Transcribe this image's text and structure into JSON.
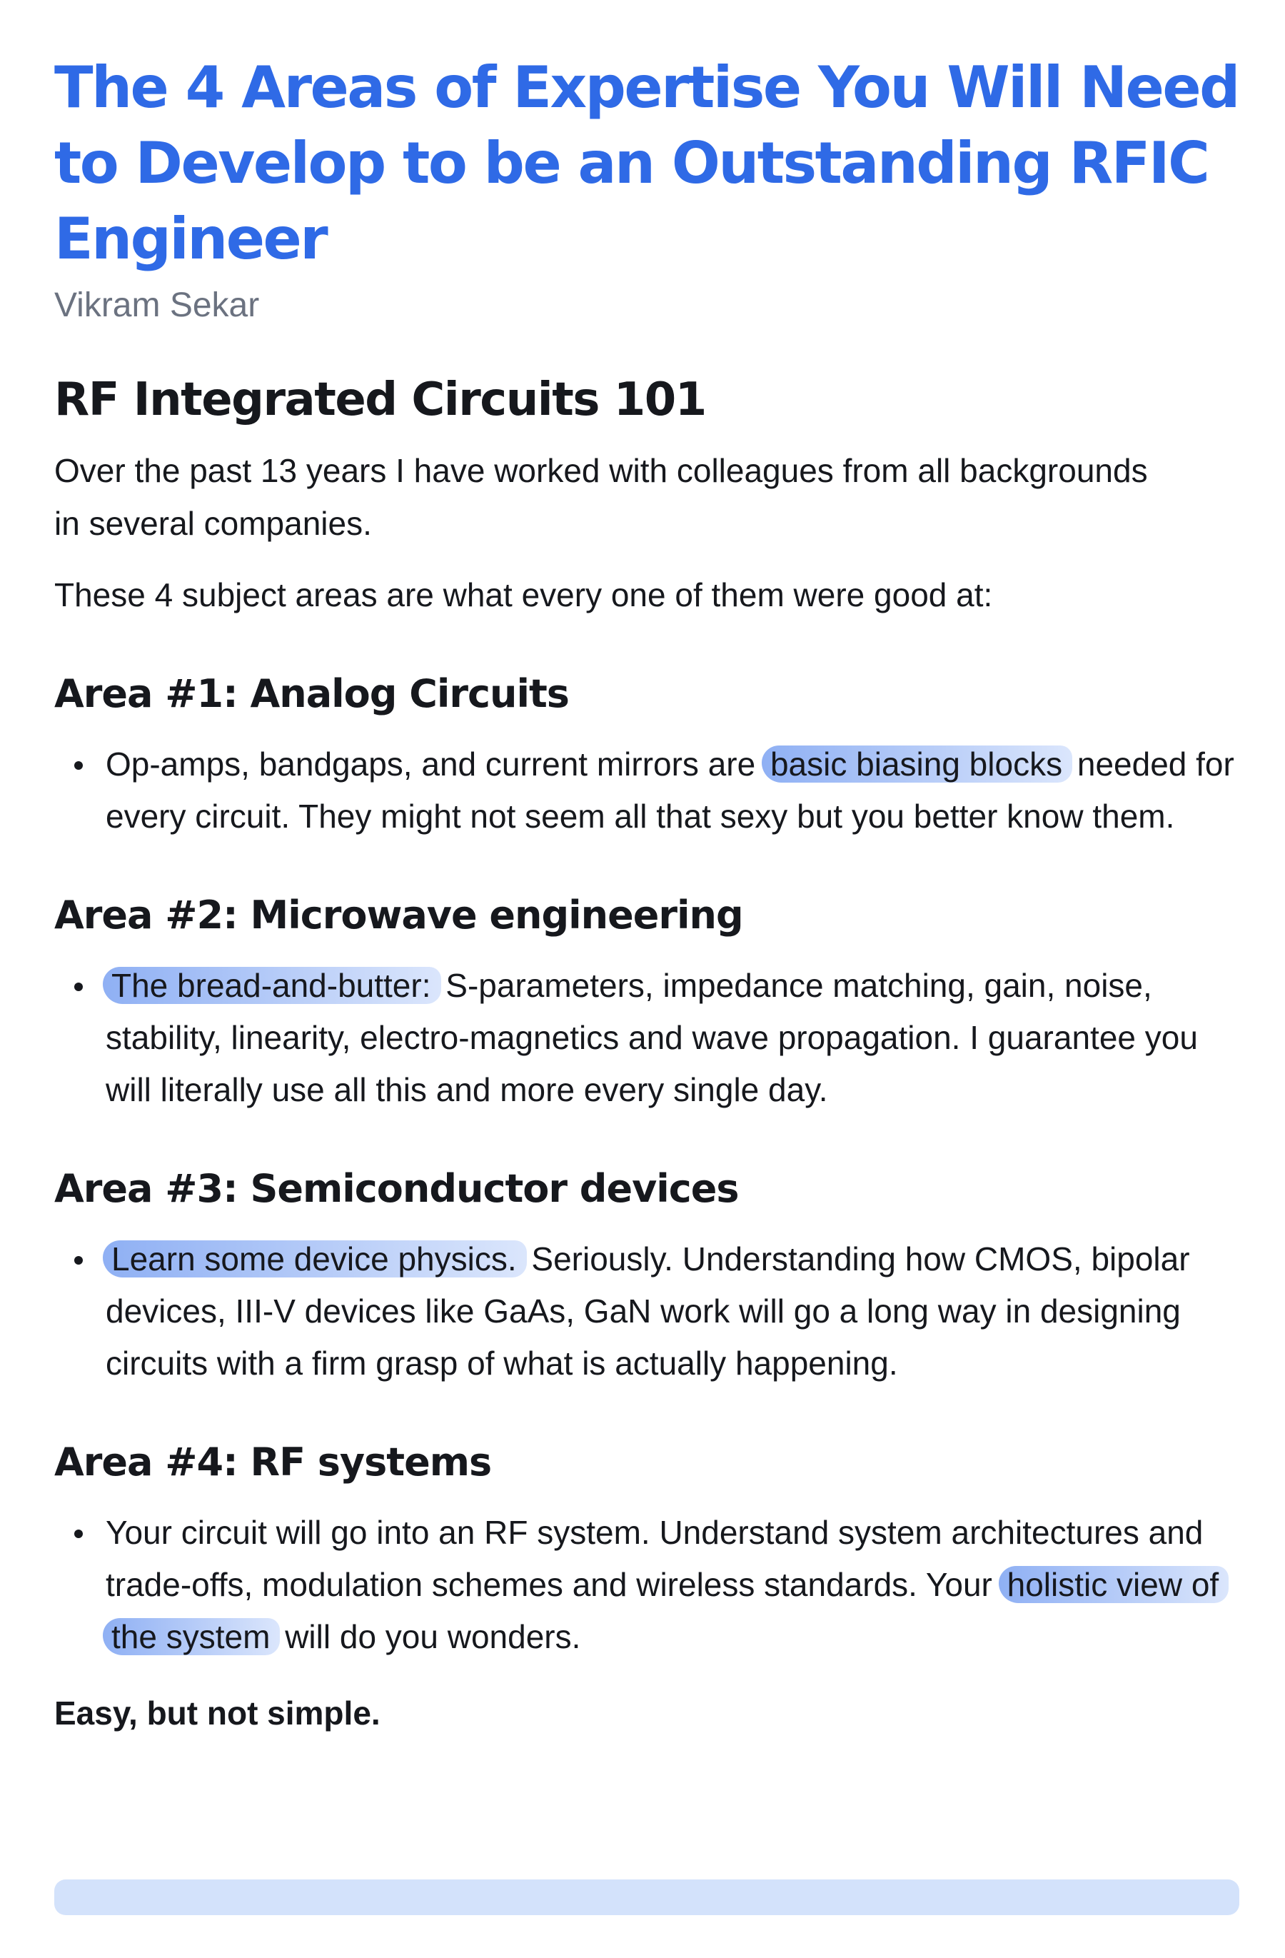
{
  "article": {
    "title": "The 4 Areas of Expertise You Will Need to Develop to be an Outstanding RFIC Engineer",
    "author": "Vikram Sekar",
    "section_title": "RF Integrated Circuits 101",
    "intro": [
      "Over the past 13 years I have worked with colleagues from all backgrounds in several companies.",
      "These 4 subject areas are what every one of them were good at:"
    ],
    "areas": [
      {
        "heading": "Area #1: Analog Circuits",
        "before": "Op-amps, bandgaps, and current mirrors are ",
        "highlight": "basic biasing blocks",
        "after": " needed for every circuit. They might not seem all that sexy but you better know them."
      },
      {
        "heading": "Area #2: Microwave engineering",
        "before": "",
        "highlight": "The bread-and-butter:",
        "after": " S-parameters, impedance matching, gain, noise, stability, linearity, electro-magnetics and wave propagation. I guarantee you will literally use all this and more every single day."
      },
      {
        "heading": "Area #3: Semiconductor devices",
        "before": "",
        "highlight": "Learn some device physics.",
        "after": " Seriously. Understanding how CMOS, bipolar devices, III-V devices like GaAs, GaN work will go a long way in designing circuits with a firm grasp of what is actually happening."
      },
      {
        "heading": "Area #4: RF systems",
        "before": "Your circuit will go into an RF system. Understand system architectures and trade-offs, modulation schemes and wireless standards. Your ",
        "highlight": "holistic view of the system",
        "after": " will do you wonders."
      }
    ],
    "closing": "Easy, but not simple."
  },
  "colors": {
    "title": "#2f6ae6",
    "author": "#6b7280",
    "body_text": "#16181d",
    "highlight": "#a9c2f6",
    "footer_bar": "#d3e2fb"
  }
}
